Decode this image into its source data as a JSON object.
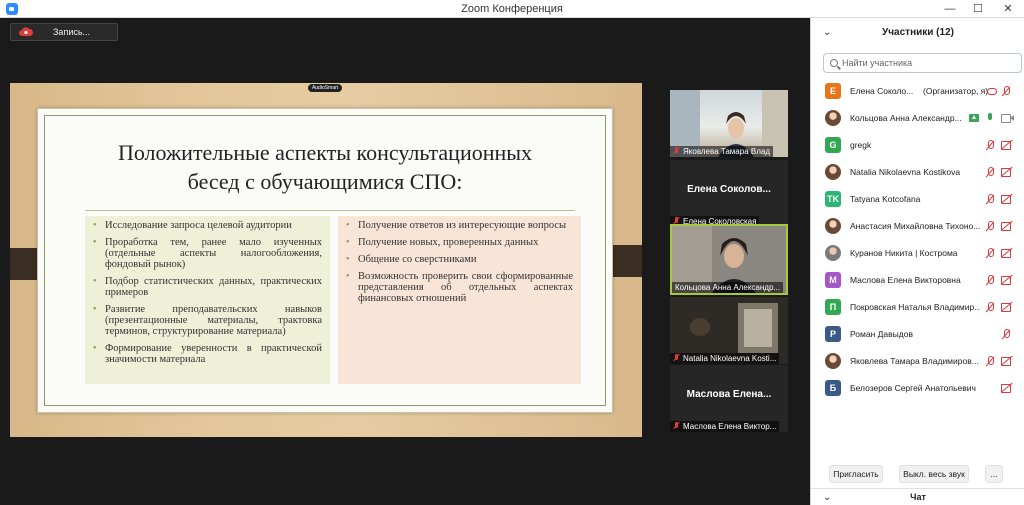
{
  "window": {
    "title": "Zoom Конференция",
    "minimize": "—",
    "maximize": "☐",
    "close": "✕"
  },
  "recording": {
    "label": "Запись..."
  },
  "slide": {
    "badge": "AudioSmart",
    "title_line1": "Положительные аспекты консультационных",
    "title_line2": "бесед с обучающимися СПО:",
    "left_bullets": [
      "Исследование запроса целевой аудитории",
      "Проработка тем, ранее мало изученных (отдельные аспекты налогообложения, фондовый рынок)",
      "Подбор статистических данных, практических примеров",
      "Развитие преподавательских навыков (презентационные материалы, трактовка терминов, структурирование материала)",
      "Формирование уверенности в практической значимости материала"
    ],
    "right_bullets": [
      "Получение ответов из интересующие вопросы",
      "Получение новых, проверенных данных",
      "Общение со сверстниками",
      "Возможность проверить свои сформированные представления об отдельных аспектах финансовых отношений"
    ]
  },
  "tiles": [
    {
      "caption": "Яковлева Тамара Влад",
      "muted": true
    },
    {
      "name": "Елена Соколов...",
      "caption": "Елена Соколовская",
      "muted": true
    },
    {
      "caption": "Кольцова Анна Александр...",
      "muted": false,
      "active": true
    },
    {
      "caption": "Natalia Nikolaevna Kosti...",
      "muted": true
    },
    {
      "name": "Маслова Елена...",
      "caption": "Маслова Елена Виктор...",
      "muted": true
    }
  ],
  "panel": {
    "title": "Участники (12)",
    "search_placeholder": "Найти участника",
    "participants": [
      {
        "initial": "Е",
        "color": "#e8751a",
        "name": "Елена Соколо...",
        "tag": "(Организатор, я)"
      },
      {
        "initial": "",
        "color": "#b9c4d6",
        "name": "Кольцова Анна Александр..."
      },
      {
        "initial": "G",
        "color": "#33a852",
        "name": "gregk"
      },
      {
        "initial": "",
        "color": "#c8a080",
        "name": "Natalia Nikolaevna Kostikova"
      },
      {
        "initial": "TK",
        "color": "#2bb673",
        "name": "Tatyana Kotcofana"
      },
      {
        "initial": "",
        "color": "#c89070",
        "name": "Анастасия Михайловна Тихоно..."
      },
      {
        "initial": "",
        "color": "#909090",
        "name": "Куранов Никита | Кострома"
      },
      {
        "initial": "М",
        "color": "#a855c8",
        "name": "Маслова Елена Викторовна"
      },
      {
        "initial": "П",
        "color": "#33a852",
        "name": "Покровская Наталья Владимир..."
      },
      {
        "initial": "Р",
        "color": "#3a5a88",
        "name": "Роман Давыдов"
      },
      {
        "initial": "",
        "color": "#c8a080",
        "name": "Яковлева Тамара Владимиров..."
      },
      {
        "initial": "Б",
        "color": "#3a5a88",
        "name": "Белозеров Сергей Анатольевич"
      }
    ],
    "invite_label": "Пригласить",
    "mute_all_label": "Выкл. весь звук",
    "more_label": "...",
    "chat_label": "Чат"
  }
}
